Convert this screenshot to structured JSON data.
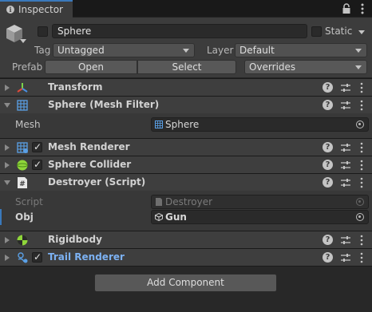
{
  "tab": {
    "label": "Inspector"
  },
  "header": {
    "name": "Sphere",
    "static_label": "Static",
    "tag_label": "Tag",
    "tag_value": "Untagged",
    "layer_label": "Layer",
    "layer_value": "Default",
    "prefab_label": "Prefab",
    "open_label": "Open",
    "select_label": "Select",
    "overrides_label": "Overrides"
  },
  "components": {
    "transform": {
      "title": "Transform"
    },
    "mesh_filter": {
      "title": "Sphere (Mesh Filter)",
      "mesh_label": "Mesh",
      "mesh_value": "Sphere"
    },
    "mesh_renderer": {
      "title": "Mesh Renderer"
    },
    "sphere_collider": {
      "title": "Sphere Collider"
    },
    "destroyer": {
      "title": "Destroyer (Script)",
      "script_label": "Script",
      "script_value": "Destroyer",
      "obj_label": "Obj",
      "obj_value": "Gun"
    },
    "rigidbody": {
      "title": "Rigidbody"
    },
    "trail_renderer": {
      "title": "Trail Renderer"
    }
  },
  "help_glyph": "?",
  "add_component_label": "Add Component",
  "colors": {
    "accent": "#3a79bb",
    "trail_title": "#7cb1f2",
    "background": "#282828"
  }
}
